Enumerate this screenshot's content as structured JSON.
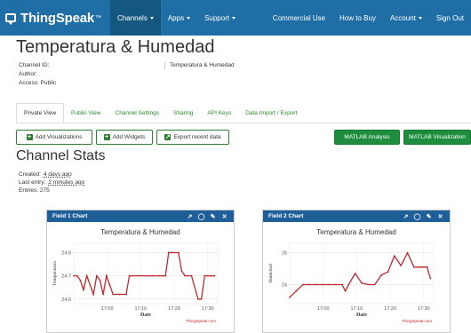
{
  "nav": {
    "brand": "ThingSpeak",
    "brand_tm": "™",
    "left_items": [
      "Channels",
      "Apps",
      "Support"
    ],
    "right_items": [
      "Commercial Use",
      "How to Buy",
      "Account",
      "Sign Out"
    ]
  },
  "channel": {
    "title": "Temperatura & Humedad",
    "id_label": "Channel ID:",
    "author_label": "Author:",
    "access_label": "Access: Public",
    "description": "Temperatura & Humedad"
  },
  "tabs": [
    "Private View",
    "Public View",
    "Channel Settings",
    "Sharing",
    "API Keys",
    "Data Import / Export"
  ],
  "buttons": {
    "add_visualizations": "Add Visualizations",
    "add_widgets": "Add Widgets",
    "export": "Export recent data",
    "matlab_analysis": "MATLAB Analysis",
    "matlab_visualization": "MATLAB Visualization"
  },
  "stats": {
    "title": "Channel Stats",
    "created_label": "Created:",
    "created_value": "4 days ago",
    "last_entry_label": "Last entry:",
    "last_entry_value": "2 minutes ago",
    "entries": "Entries: 275"
  },
  "colors": {
    "nav": "#1f6fa6",
    "panel_head": "#1f5f99",
    "line": "#c0282d",
    "green": "#1e8e3e"
  },
  "chart_data": [
    {
      "type": "line",
      "panel_title": "Field 1 Chart",
      "title": "Temperatura & Humedad",
      "xlabel": "Date",
      "ylabel": "Temperatura",
      "credit": "ThingSpeak.com",
      "x_ticks": [
        "17:00",
        "17:10",
        "17:20",
        "17:30"
      ],
      "y_ticks": [
        24.6,
        24.7,
        24.8
      ],
      "ylim": [
        24.58,
        24.84
      ],
      "xlim": [
        0,
        44
      ],
      "grid": true,
      "x": [
        0,
        1,
        2,
        3,
        4,
        6,
        7,
        8,
        9,
        10,
        11,
        12,
        14,
        16,
        17,
        18,
        20,
        22,
        23,
        24,
        26,
        27,
        28,
        29,
        30,
        32,
        33,
        34,
        36,
        38,
        39,
        40,
        41,
        42,
        43
      ],
      "y": [
        24.7,
        24.7,
        24.68,
        24.64,
        24.7,
        24.62,
        24.7,
        24.68,
        24.62,
        24.7,
        24.66,
        24.62,
        24.62,
        24.62,
        24.7,
        24.7,
        24.7,
        24.7,
        24.7,
        24.7,
        24.7,
        24.7,
        24.7,
        24.8,
        24.8,
        24.8,
        24.72,
        24.7,
        24.7,
        24.6,
        24.6,
        24.7,
        24.7,
        24.7,
        24.7
      ]
    },
    {
      "type": "line",
      "panel_title": "Field 2 Chart",
      "title": "Temperatura & Humedad",
      "xlabel": "Date",
      "ylabel": "Humedad",
      "credit": "ThingSpeak.com",
      "x_ticks": [
        "17:00",
        "17:10",
        "17:20",
        "17:30"
      ],
      "y_ticks": [
        24,
        26
      ],
      "ylim": [
        22.8,
        26.6
      ],
      "xlim": [
        0,
        44
      ],
      "grid": true,
      "x": [
        0,
        2,
        4,
        6,
        8,
        10,
        12,
        14,
        16,
        17,
        18,
        20,
        22,
        24,
        26,
        28,
        30,
        32,
        34,
        36,
        38,
        40,
        41,
        42,
        43
      ],
      "y": [
        23.2,
        23.6,
        24,
        24,
        24,
        24,
        24,
        24,
        24,
        23.6,
        24,
        24.7,
        24.1,
        24,
        24,
        24.6,
        24.8,
        25.8,
        25.2,
        26.0,
        25.1,
        25.1,
        25.1,
        25.1,
        24.4
      ]
    }
  ]
}
